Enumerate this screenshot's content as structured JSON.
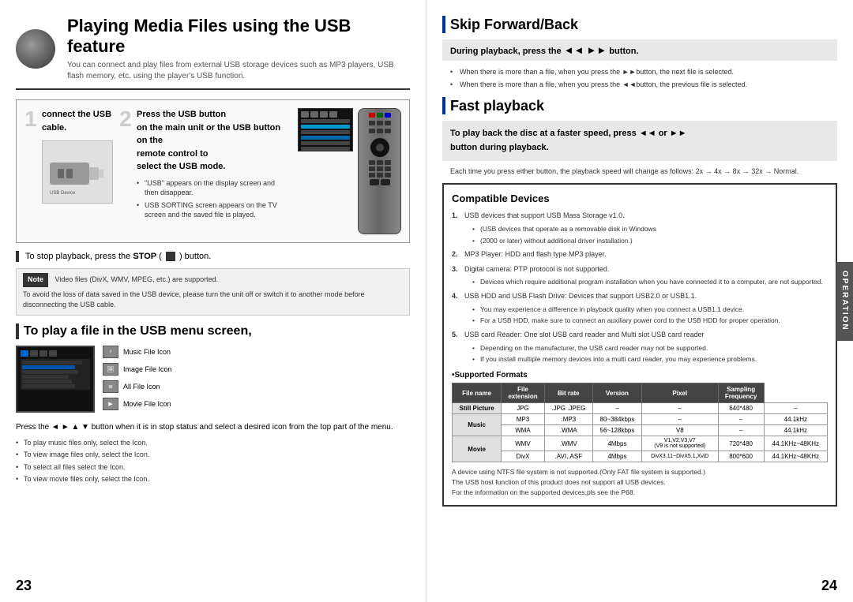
{
  "left_page": {
    "page_number": "23",
    "header": {
      "title": "Playing Media Files using the USB  feature",
      "subtitle": "You can connect and play files from external USB storage devices such as  MP3 players, USB flash memory,\netc. using the player's USB  function."
    },
    "step1": {
      "number": "1",
      "text": "connect the USB cable."
    },
    "step2": {
      "number": "2",
      "text_line1": "Press the USB button",
      "text_line2": "on the main unit or the",
      "text_bold": "USB",
      "text_line3": "button on the",
      "text_line4": "remote control to",
      "text_line5": "select the USB mode.",
      "bullets": [
        "\"USB\" appears on the display screen and then disappear.",
        "USB SORTING screen appears on the TV screen and the saved file is played."
      ]
    },
    "stop_section": {
      "bar_label": "■",
      "text": "To stop playback, press the STOP (    ) button."
    },
    "note": {
      "label": "Note",
      "bullets": [
        "Video files (DivX, WMV, MPEG, etc.)  are  supported.",
        "To avoid the loss of data saved in the USB device, please turn the unit off or switch it to another mode before disconnecting the USB cable."
      ]
    },
    "usb_menu": {
      "section_title": "To play a file in the USB menu screen,",
      "icons": [
        {
          "icon": "♪",
          "label": "Music File Icon"
        },
        {
          "icon": "🖼",
          "label": "Image File Icon"
        },
        {
          "icon": "≣",
          "label": "All File Icon"
        },
        {
          "icon": "▶",
          "label": "Movie File Icon"
        }
      ],
      "press_text": "Press the ◄ ► ▲ ▼ button when it is in stop status and select a desired icon from the top part of the menu.",
      "sub_bullets": [
        "To play music files only, select the      Icon.",
        "To view image files only, select the      Icon.",
        "To select all files select the      Icon.",
        "To view movie files only, select the      Icon."
      ]
    }
  },
  "right_page": {
    "page_number": "24",
    "skip_section": {
      "title": "Skip Forward/Back",
      "highlighted_text": "During playback, press the ◄◄  ►►button.",
      "bullets": [
        "When there is more than a file, when you press the      ►►button, the next file is selected.",
        "When there is more than a file, when you press the      ◄◄button, the previous file is selected."
      ]
    },
    "fast_playback": {
      "title": "Fast playback",
      "highlighted_text": "To play back the disc at a faster speed, press ◄◄  or ►► button during playback.",
      "speed_text": "Each time you press either button, the playback speed will change as follows:\n2x → 4x → 8x → 32x → Normal."
    },
    "compatible": {
      "title": "Compatible Devices",
      "items": [
        {
          "num": "1.",
          "text": "USB devices that support USB Mass Storage v1.0.",
          "sub": [
            "(USB devices that operate as a removable disk in Windows",
            "(2000 or later) without additional driver installation.)"
          ]
        },
        {
          "num": "2.",
          "text": "MP3 Player: HDD and flash type MP3 player."
        },
        {
          "num": "3.",
          "text": "Digital camera: PTP protocol is not supported.",
          "sub": [
            "Devices which require additional program installation when you have connected it to a computer, are not supported."
          ]
        },
        {
          "num": "4.",
          "text": "USB HDD and USB Flash Drive: Devices that support USB2.0 or USB1.1.",
          "sub": [
            "You may experience a difference in playback quality when you connect a USB1.1 device.",
            "For a USB HDD, make sure to connect an auxiliary power cord to the USB HDD for proper operation."
          ]
        },
        {
          "num": "5.",
          "text": "USB card Reader: One slot USB card reader and Multi slot USB card reader",
          "sub": [
            "Depending on the manufacturer, the USB card reader may not be supported.",
            "If you install multiple memory devices into a multi card reader, you may experience problems."
          ]
        }
      ]
    },
    "supported_formats": {
      "title": "•Supported Formats",
      "table": {
        "headers": [
          "File name",
          "File\nextension",
          "Bit rate",
          "Version",
          "Pixel",
          "Sampling\nFrequency"
        ],
        "rows": [
          {
            "category": "Still Picture",
            "spans": 1,
            "name": "JPG",
            "extension": ".JPG .JPEG",
            "bitrate": "–",
            "version": "–",
            "pixel": "640*480",
            "freq": "–"
          },
          {
            "category": "Music",
            "name": "MP3",
            "extension": ".MP3",
            "bitrate": "80~384kbps",
            "version": "–",
            "pixel": "–",
            "freq": "44.1kHz"
          },
          {
            "category": "",
            "name": "WMA",
            "extension": ".WMA",
            "bitrate": "56~128kbps",
            "version": "V8",
            "pixel": "–",
            "freq": "44.1kHz"
          },
          {
            "category": "Movie",
            "name": "WMV",
            "extension": ".WMV",
            "bitrate": "4Mbps",
            "version": "V1,V2,V3,V7\n(V9 is not supported)",
            "pixel": "720*480",
            "freq": "44.1KHz~48KHz"
          },
          {
            "category": "",
            "name": "DivX",
            "extension": ".AVI,.ASF",
            "bitrate": "4Mbps",
            "version": "DivX3.11~DivX5.1,XviD",
            "pixel": "800*600",
            "freq": "44.1KHz~48KHz"
          }
        ]
      }
    },
    "footer_notes": [
      "A device using NTFS file system is not supported.(Only FAT file system is supported.)",
      "The USB host function of this product does not support all USB devices.",
      "For the information on the supported devices,pls see the P68."
    ],
    "operation_label": "OPERATION"
  }
}
